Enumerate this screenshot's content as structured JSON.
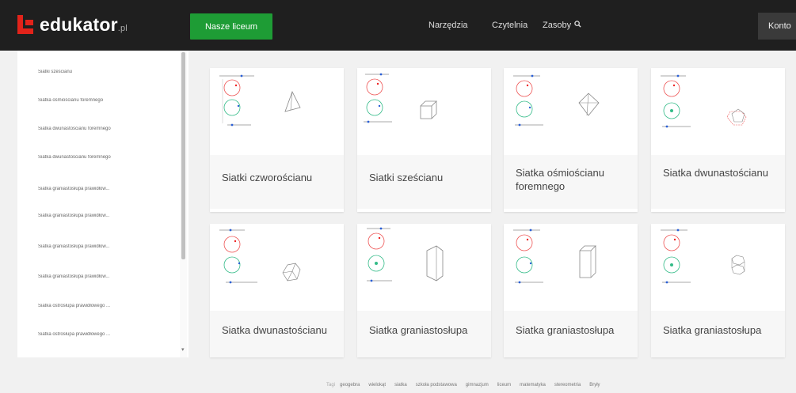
{
  "brand": {
    "name": "edukator",
    "suffix": ".pl"
  },
  "header": {
    "liceum_button": "Nasze liceum",
    "nav": [
      {
        "label": "Narzędzia"
      },
      {
        "label": "Czytelnia"
      },
      {
        "label": "Zasoby",
        "icon": "search-icon"
      }
    ],
    "account_label": "Konto"
  },
  "sidebar": {
    "items": [
      {
        "label": "Siatki sześcianu"
      },
      {
        "label": "Siatka ośmiościanu foremnego"
      },
      {
        "label": "Siatka dwunastościanu foremnego"
      },
      {
        "label": "Siatka dwunastościanu foremnego"
      },
      {
        "label": "Siatka graniastosłupa prawidłow..."
      },
      {
        "label": "Siatka graniastosłupa prawidłow..."
      },
      {
        "label": "Siatka graniastosłupa prawidłow..."
      },
      {
        "label": "Siatka graniastosłupa prawidłow..."
      },
      {
        "label": "Siatka ostrosłupa prawidłowego ..."
      },
      {
        "label": "Siatka ostrosłupa prawidłowego ..."
      }
    ]
  },
  "cards": [
    {
      "title": "Siatki czworościanu",
      "shape": "tetrahedron"
    },
    {
      "title": "Siatki sześcianu",
      "shape": "cube"
    },
    {
      "title": "Siatka ośmiościanu foremnego",
      "shape": "octahedron"
    },
    {
      "title": "Siatka dwunastościanu",
      "shape": "dodecahedron"
    },
    {
      "title": "Siatka dwunastościanu",
      "shape": "icosahedron"
    },
    {
      "title": "Siatka graniastosłupa",
      "shape": "prism3"
    },
    {
      "title": "Siatka graniastosłupa",
      "shape": "prism4"
    },
    {
      "title": "Siatka graniastosłupa",
      "shape": "prism6"
    }
  ],
  "tags": {
    "label": "Tagi",
    "items": [
      "geogebra",
      "wielokąt",
      "siatka",
      "szkoła podstawowa",
      "gimnazjum",
      "liceum",
      "matematyka",
      "stereometria",
      "Bryły"
    ]
  },
  "colors": {
    "accent": "#1e9c35",
    "brand_red": "#e2231a",
    "topbar": "#1f1f1f"
  }
}
